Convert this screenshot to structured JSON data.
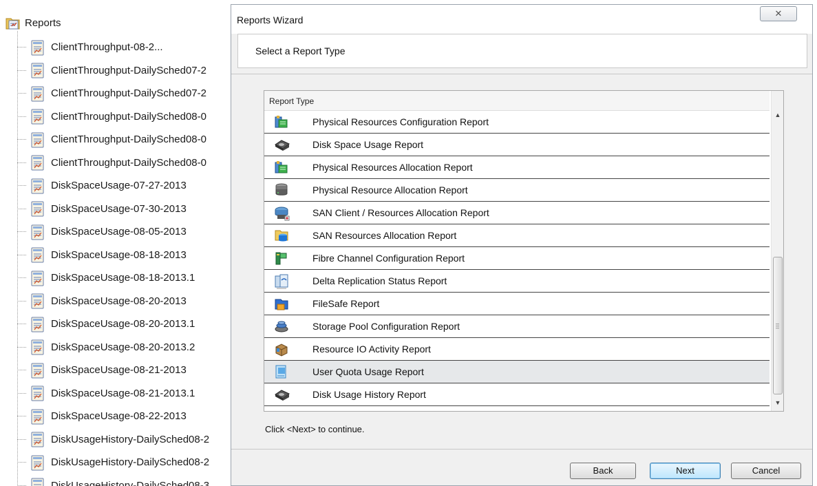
{
  "tree": {
    "root_label": "Reports",
    "items": [
      "ClientThroughput-08-2...",
      "ClientThroughput-DailySched07-2",
      "ClientThroughput-DailySched07-2",
      "ClientThroughput-DailySched08-0",
      "ClientThroughput-DailySched08-0",
      "ClientThroughput-DailySched08-0",
      "DiskSpaceUsage-07-27-2013",
      "DiskSpaceUsage-07-30-2013",
      "DiskSpaceUsage-08-05-2013",
      "DiskSpaceUsage-08-18-2013",
      "DiskSpaceUsage-08-18-2013.1",
      "DiskSpaceUsage-08-20-2013",
      "DiskSpaceUsage-08-20-2013.1",
      "DiskSpaceUsage-08-20-2013.2",
      "DiskSpaceUsage-08-21-2013",
      "DiskSpaceUsage-08-21-2013.1",
      "DiskSpaceUsage-08-22-2013",
      "DiskUsageHistory-DailySched08-2",
      "DiskUsageHistory-DailySched08-2",
      "DiskUsageHistory-DailySched08-3"
    ]
  },
  "dialog": {
    "title": "Reports Wizard",
    "close_glyph": "✕",
    "header": "Select a Report Type",
    "column_header": "Report Type",
    "report_types": [
      {
        "label": "Physical Resources Configuration Report",
        "icon": "physical-resources-icon"
      },
      {
        "label": "Disk Space Usage Report",
        "icon": "disk-icon"
      },
      {
        "label": "Physical Resources Allocation Report",
        "icon": "physical-resources-icon"
      },
      {
        "label": "Physical Resource Allocation Report",
        "icon": "server-stack-icon"
      },
      {
        "label": "SAN Client / Resources Allocation Report",
        "icon": "san-client-icon"
      },
      {
        "label": "SAN Resources Allocation Report",
        "icon": "san-resources-icon"
      },
      {
        "label": "Fibre Channel Configuration Report",
        "icon": "fibre-channel-icon"
      },
      {
        "label": "Delta Replication Status Report",
        "icon": "replication-icon"
      },
      {
        "label": "FileSafe Report",
        "icon": "filesafe-icon"
      },
      {
        "label": "Storage Pool Configuration Report",
        "icon": "storage-pool-icon"
      },
      {
        "label": "Resource IO Activity Report",
        "icon": "io-activity-icon"
      },
      {
        "label": "User Quota Usage Report",
        "icon": "user-quota-icon"
      },
      {
        "label": "Disk Usage History Report",
        "icon": "disk-icon"
      }
    ],
    "selected_index": 11,
    "hint": "Click <Next> to continue.",
    "buttons": {
      "back": "Back",
      "next": "Next",
      "cancel": "Cancel"
    }
  }
}
